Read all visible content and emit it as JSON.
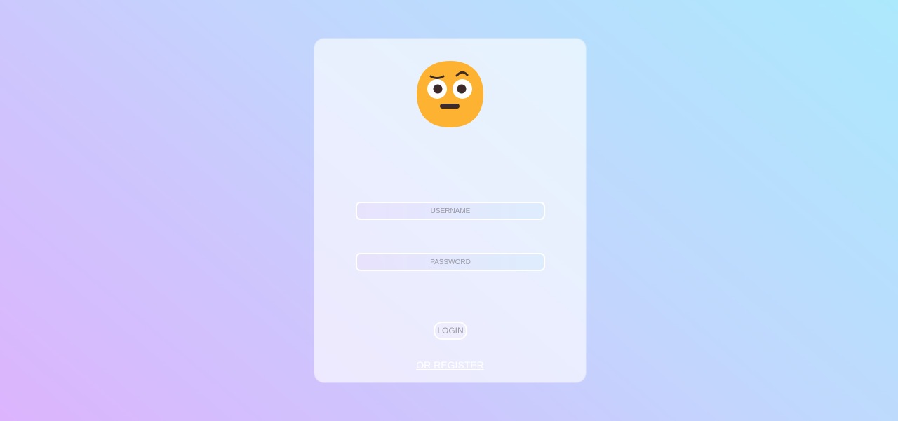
{
  "login_card": {
    "avatar_icon": "raised-eyebrow-face-emoji",
    "username": {
      "placeholder": "USERNAME",
      "value": ""
    },
    "password": {
      "placeholder": "PASSWORD",
      "value": ""
    },
    "login_label": "LOGIN",
    "register_label": "OR REGISTER"
  },
  "colors": {
    "emoji_face": "#FDB331",
    "emoji_features": "#3D2B2B",
    "card_background": "rgba(255,255,255,0.63)",
    "link_text": "#FFFFFF"
  }
}
